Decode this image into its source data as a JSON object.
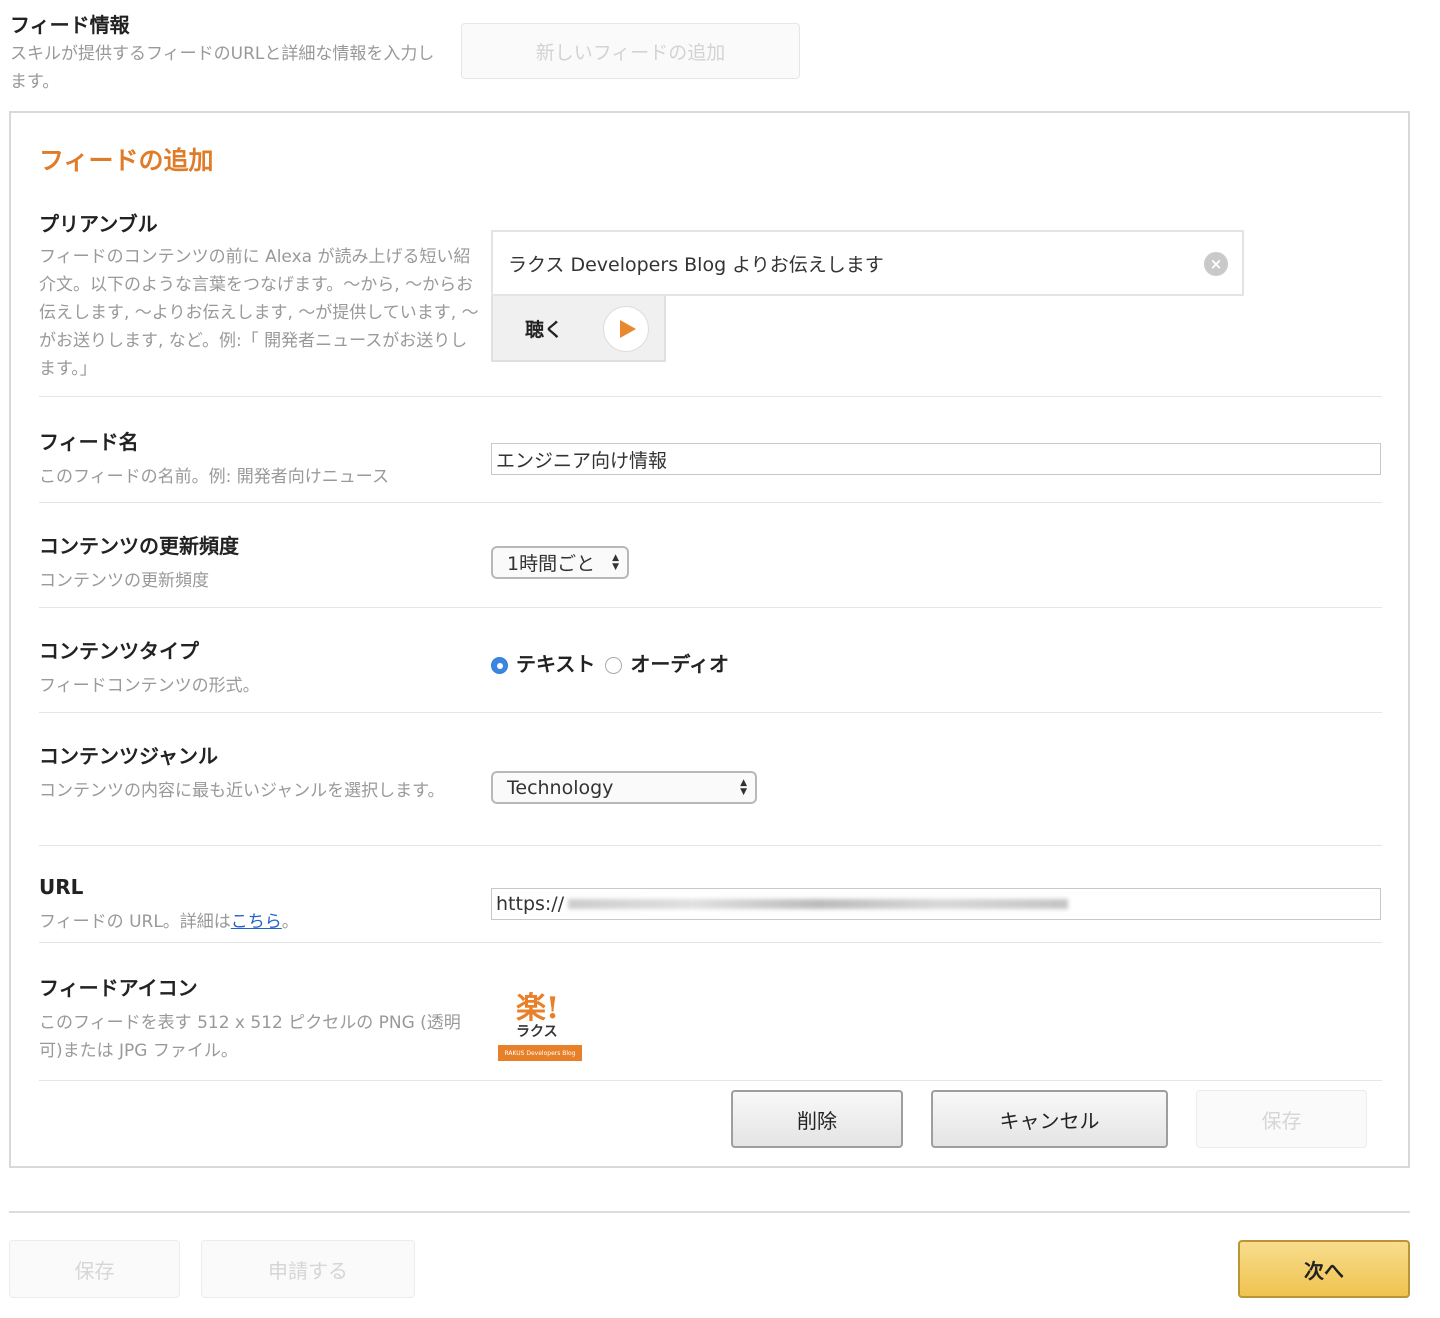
{
  "header": {
    "title": "フィード情報",
    "description": "スキルが提供するフィードのURLと詳細な情報を入力します。",
    "new_feed_button": "新しいフィードの追加"
  },
  "panel": {
    "title": "フィードの追加",
    "preamble": {
      "title": "プリアンブル",
      "description": "フィードのコンテンツの前に Alexa が読み上げる短い紹介文。以下のような言葉をつなげます。〜から, 〜からお伝えします, 〜よりお伝えします, 〜が提供しています, 〜がお送りします, など。例:「 開発者ニュースがお送りします。」",
      "value": "ラクス Developers Blog よりお伝えします",
      "clear_icon": "clear-icon",
      "listen_label": "聴く",
      "play_icon": "play-icon"
    },
    "feed_name": {
      "title": "フィード名",
      "description": "このフィードの名前。例: 開発者向けニュース",
      "value": "エンジニア向け情報"
    },
    "frequency": {
      "title": "コンテンツの更新頻度",
      "description": "コンテンツの更新頻度",
      "selected": "1時間ごと"
    },
    "content_type": {
      "title": "コンテンツタイプ",
      "description": "フィードコンテンツの形式。",
      "options": [
        "テキスト",
        "オーディオ"
      ],
      "selected": "テキスト"
    },
    "genre": {
      "title": "コンテンツジャンル",
      "description": "コンテンツの内容に最も近いジャンルを選択します。",
      "selected": "Technology"
    },
    "url": {
      "title": "URL",
      "description_prefix": "フィードの URL。詳細は",
      "link_text": "こちら",
      "description_suffix": "。",
      "value_visible": "https://"
    },
    "feed_icon": {
      "title": "フィードアイコン",
      "description": "このフィードを表す 512 x 512 ピクセルの PNG (透明可)または JPG ファイル。",
      "logo_mark": "楽!",
      "logo_text": "ラクス",
      "logo_band": "RAKUS Developers Blog"
    },
    "buttons": {
      "delete": "削除",
      "cancel": "キャンセル",
      "save": "保存"
    }
  },
  "footer": {
    "save": "保存",
    "submit": "申請する",
    "next": "次へ"
  },
  "colors": {
    "accent": "#e07b27",
    "link": "#2062c8",
    "radio_selected": "#3b86e0",
    "primary_button": "#efc34f"
  }
}
